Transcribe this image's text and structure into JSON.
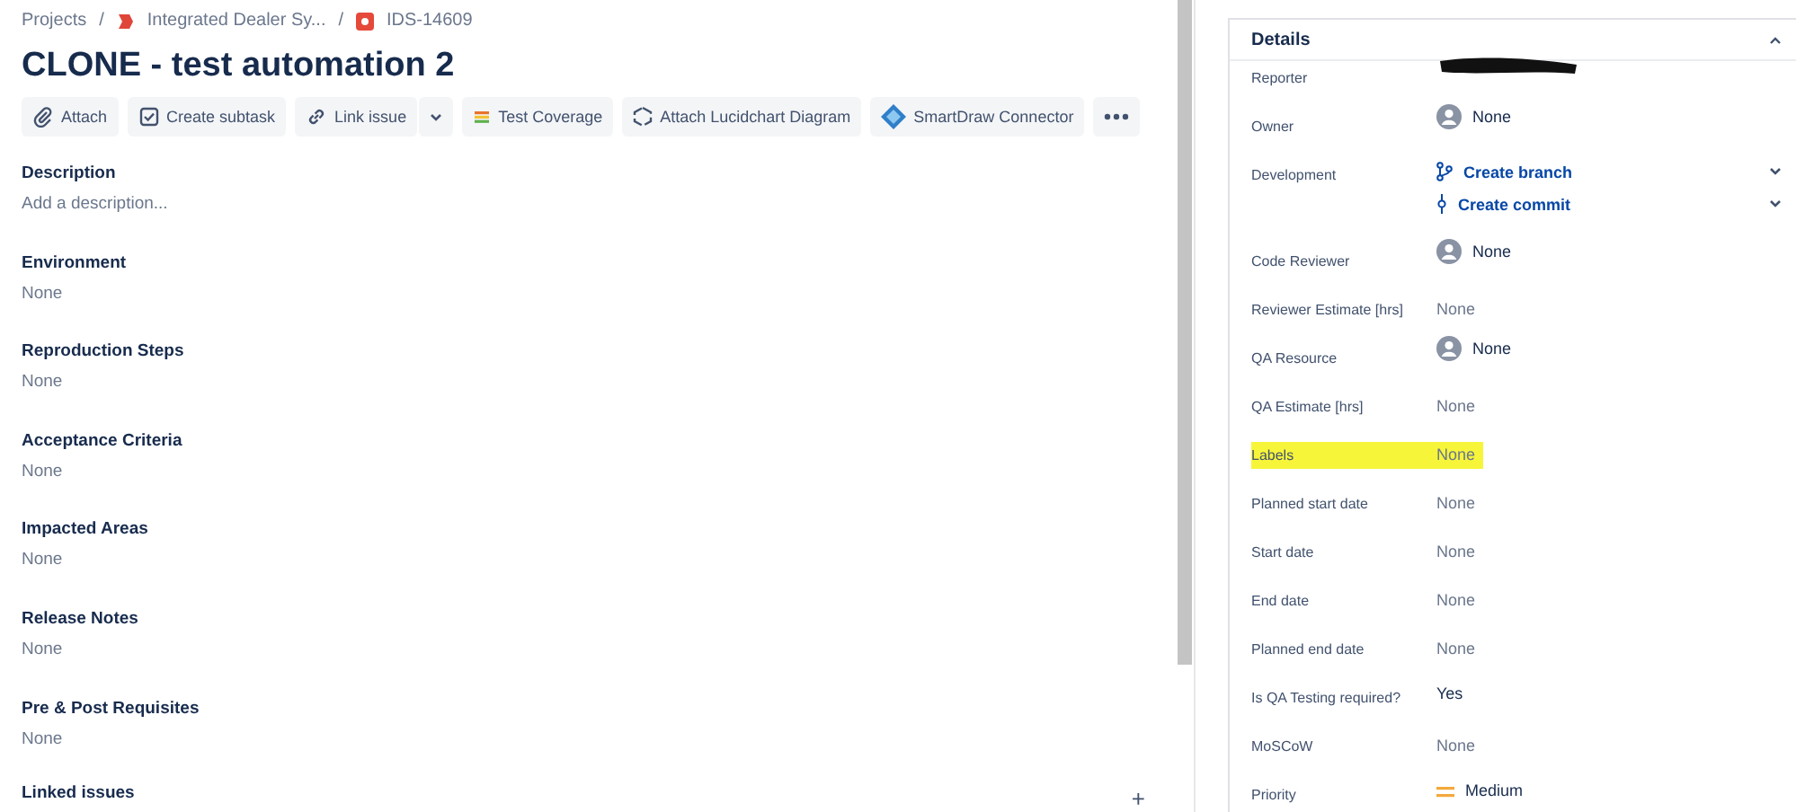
{
  "breadcrumb_separator": "/",
  "breadcrumbs": [
    {
      "label": "Projects",
      "kind": "text"
    },
    {
      "label": "Integrated Dealer Sy...",
      "kind": "project"
    },
    {
      "label": "IDS-14609",
      "kind": "issue"
    }
  ],
  "title": "CLONE - test automation 2",
  "toolbar": [
    {
      "label": "Attach",
      "kind": "attach"
    },
    {
      "label": "Create subtask",
      "kind": "subtask"
    },
    {
      "label": "Link issue",
      "kind": "link"
    },
    {
      "label": "Test Coverage",
      "kind": "coverage"
    },
    {
      "label": "Attach Lucidchart Diagram",
      "kind": "lucid"
    },
    {
      "label": "SmartDraw Connector",
      "kind": "smartdraw"
    }
  ],
  "fields": [
    {
      "label": "Description",
      "value": "Add a description..."
    },
    {
      "label": "Environment",
      "value": "None"
    },
    {
      "label": "Reproduction Steps",
      "value": "None"
    },
    {
      "label": "Acceptance Criteria",
      "value": "None"
    },
    {
      "label": "Impacted Areas",
      "value": "None"
    },
    {
      "label": "Release Notes",
      "value": "None"
    },
    {
      "label": "Pre & Post Requisites",
      "value": "None"
    }
  ],
  "linked_issues": {
    "label": "Linked issues",
    "add": "+"
  },
  "details": {
    "title": "Details",
    "expanded": true,
    "rows": [
      {
        "label": "Reporter",
        "kind": "redacted",
        "highlighted": false
      },
      {
        "label": "Owner",
        "kind": "user",
        "value": "None",
        "highlighted": false
      },
      {
        "label": "Development",
        "kind": "links",
        "links": [
          "Create branch",
          "Create commit"
        ],
        "highlighted": false
      },
      {
        "label": "Code Reviewer",
        "kind": "user",
        "value": "None",
        "highlighted": false
      },
      {
        "label": "Reviewer Estimate [hrs]",
        "kind": "text",
        "value": "None",
        "highlighted": false
      },
      {
        "label": "QA Resource",
        "kind": "user",
        "value": "None",
        "highlighted": false
      },
      {
        "label": "QA Estimate [hrs]",
        "kind": "text",
        "value": "None",
        "highlighted": false
      },
      {
        "label": "Labels",
        "kind": "text",
        "value": "None",
        "highlighted": true
      },
      {
        "label": "Planned start date",
        "kind": "text",
        "value": "None",
        "highlighted": false
      },
      {
        "label": "Start date",
        "kind": "text",
        "value": "None",
        "highlighted": false
      },
      {
        "label": "End date",
        "kind": "text",
        "value": "None",
        "highlighted": false
      },
      {
        "label": "Planned end date",
        "kind": "text",
        "value": "None",
        "highlighted": false
      },
      {
        "label": "Is QA Testing required?",
        "kind": "value",
        "value": "Yes",
        "highlighted": false
      },
      {
        "label": "MoSCoW",
        "kind": "text",
        "value": "None",
        "highlighted": false
      },
      {
        "label": "Priority",
        "kind": "priority",
        "value": "Medium",
        "highlighted": false
      }
    ]
  }
}
